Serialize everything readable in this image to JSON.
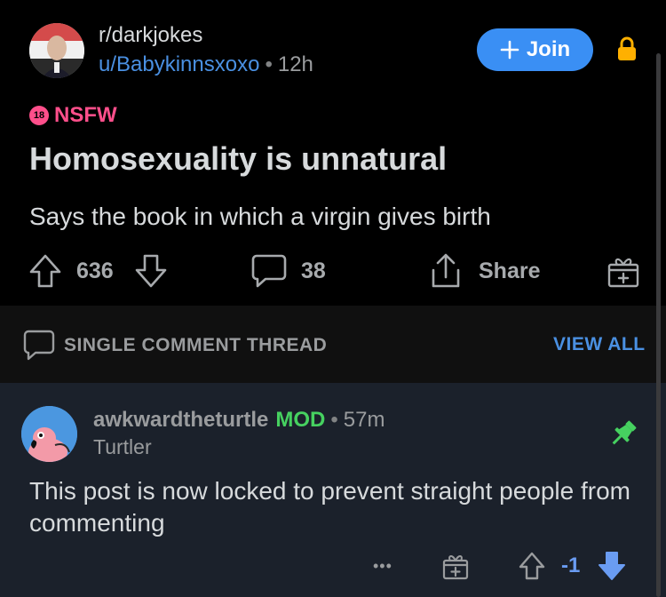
{
  "post": {
    "subreddit": "r/darkjokes",
    "author": "u/Babykinnsxoxo",
    "separator": "•",
    "age": "12h",
    "join_label": "Join",
    "nsfw_badge": "18",
    "nsfw_label": "NSFW",
    "title": "Homosexuality is unnatural",
    "body": "Says the book in which a virgin gives birth",
    "upvotes": "636",
    "comments": "38",
    "share_label": "Share"
  },
  "thread": {
    "label": "SINGLE COMMENT THREAD",
    "view_all": "VIEW ALL"
  },
  "comment": {
    "author": "awkwardtheturtle",
    "mod_badge": "MOD",
    "separator": "•",
    "age": "57m",
    "flair": "Turtler",
    "body": "This post is now locked to prevent straight people from commenting",
    "more": "•••",
    "score": "-1"
  },
  "colors": {
    "accent": "#3a8ff4",
    "nsfw": "#ff4f8b",
    "mod": "#46d160",
    "lock": "#ffb000",
    "downvote": "#6a9cf2"
  },
  "icons": [
    "lock-icon",
    "upvote-icon",
    "downvote-icon",
    "comment-icon",
    "share-icon",
    "award-icon",
    "pin-icon",
    "more-icon"
  ]
}
